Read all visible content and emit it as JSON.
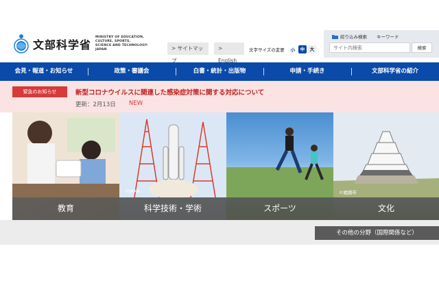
{
  "header": {
    "logo_text": "文部科学省",
    "logo_en_lines": [
      "MINISTRY OF EDUCATION,",
      "CULTURE, SPORTS,",
      "SCIENCE AND TECHNOLOGY-JAPAN"
    ],
    "sitemap_label": "> サイトマップ",
    "english_label": "> English",
    "font_size_label": "文字サイズの変更",
    "font_small": "小",
    "font_medium": "中",
    "font_large": "大",
    "search": {
      "refine_label": "絞り込み検索",
      "keyword_label": "キーワード",
      "placeholder": "サイト内検索",
      "button_label": "検索"
    }
  },
  "nav": {
    "items": [
      {
        "label": "会見・報道・お知らせ"
      },
      {
        "label": "政策・審議会"
      },
      {
        "label": "白書・統計・出版物"
      },
      {
        "label": "申請・手続き"
      },
      {
        "label": "文部科学省の紹介"
      }
    ]
  },
  "alert": {
    "badge": "緊急のお知らせ",
    "title": "新型コロナウイルスに関連した感染症対策に関する対応について",
    "date": "更新：2月13日",
    "new_label": "NEW"
  },
  "features": {
    "panels": [
      {
        "label": "教育",
        "credit": ""
      },
      {
        "label": "科学技術・学術",
        "credit": "©JAXA"
      },
      {
        "label": "スポーツ",
        "credit": ""
      },
      {
        "label": "文化",
        "credit": "©姫路市"
      }
    ]
  },
  "other_fields_label": "その他の分野（国際関係など）",
  "colors": {
    "primary": "#0a4aa8",
    "alert_bg": "#fbe3e3",
    "alert_text": "#c02020",
    "alert_badge": "#d63a3a"
  }
}
